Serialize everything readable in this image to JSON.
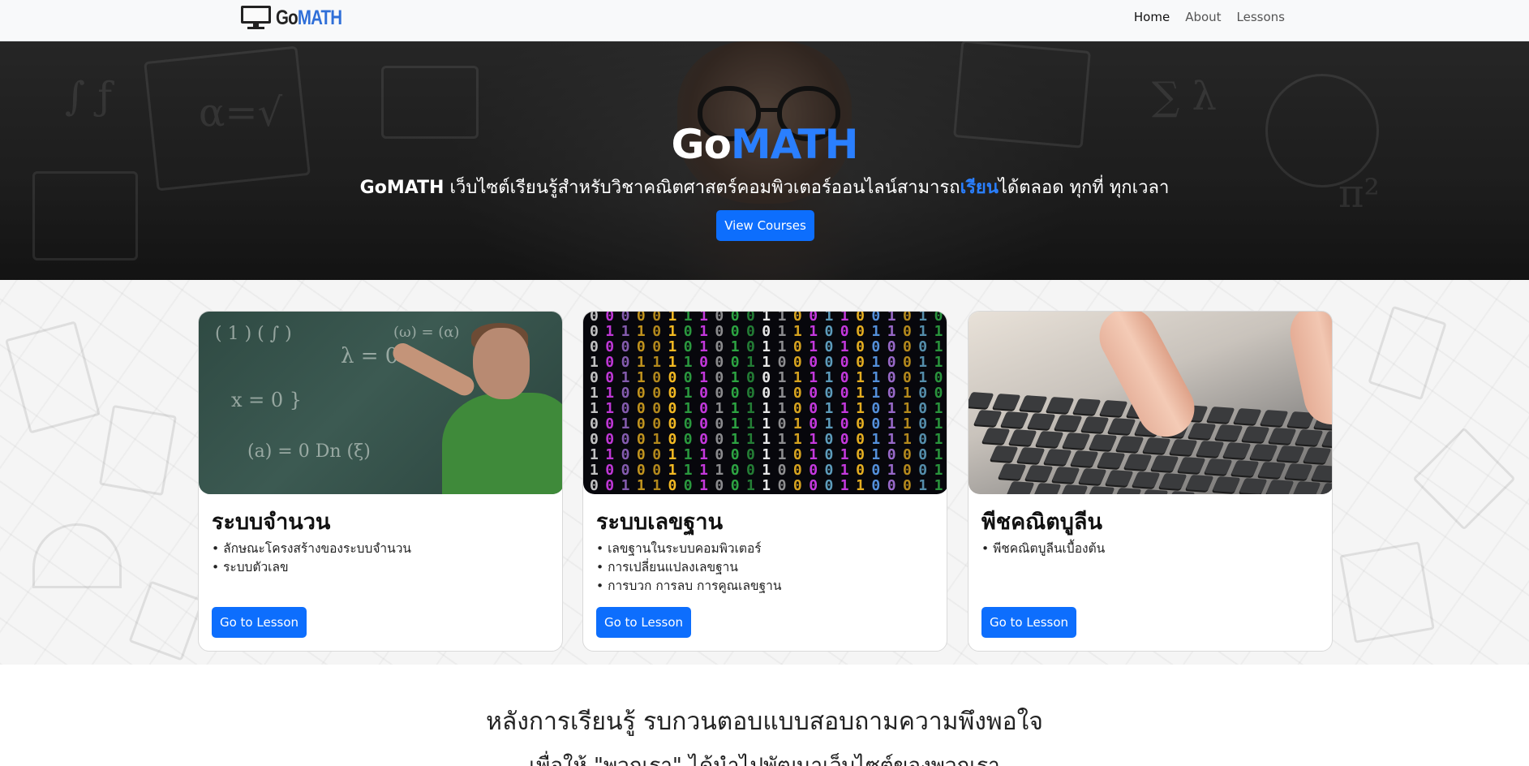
{
  "navbar": {
    "brand_go": "Go",
    "brand_math": "MATH",
    "brand_icon": "monitor-icon",
    "links": [
      {
        "label": "Home",
        "active": true
      },
      {
        "label": "About",
        "active": false
      },
      {
        "label": "Lessons",
        "active": false
      }
    ]
  },
  "hero": {
    "title_go": "Go",
    "title_math": "MATH",
    "subtitle_brand": "GoMATH",
    "subtitle_part1": " เว็บไซต์เรียนรู้สำหรับวิชาคณิตศาสตร์คอมพิวเตอร์ออนไลน์สามารถ",
    "subtitle_highlight": "เรียน",
    "subtitle_part2": "ได้ตลอด ทุกที่ ทุกเวลา",
    "button_label": "View Courses"
  },
  "cards": [
    {
      "title": "ระบบจำนวน",
      "items": [
        "• ลักษณะโครงสร้างของระบบจำนวน",
        "• ระบบตัวเลข"
      ],
      "button_label": "Go to Lesson"
    },
    {
      "title": "ระบบเลขฐาน",
      "items": [
        "• เลขฐานในระบบคอมพิวเตอร์",
        "• การเปลี่ยนแปลงเลขฐาน",
        "• การบวก การลบ การคูณเลขฐาน"
      ],
      "button_label": "Go to Lesson"
    },
    {
      "title": "พีชคณิตบูลีน",
      "items": [
        "• พีชคณิตบูลีนเบื้องต้น"
      ],
      "button_label": "Go to Lesson"
    }
  ],
  "survey": {
    "title": "หลังการเรียนรู้ รบกวนตอบแบบสอบถามความพึงพอใจ",
    "subtitle": "เพื่อให้ \"พวกเรา\" ได้นำไปพัฒนาเว็บไซต์ของพวกเรา"
  },
  "colors": {
    "accent": "#0d6efd",
    "brand_blue": "#2f6fd8",
    "hero_highlight": "#2a7fff"
  }
}
